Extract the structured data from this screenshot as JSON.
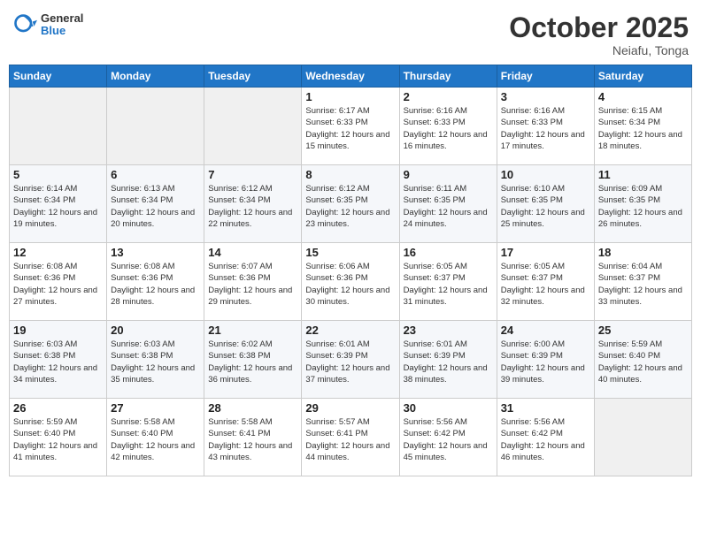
{
  "logo": {
    "general": "General",
    "blue": "Blue"
  },
  "header": {
    "month": "October 2025",
    "location": "Neiafu, Tonga"
  },
  "weekdays": [
    "Sunday",
    "Monday",
    "Tuesday",
    "Wednesday",
    "Thursday",
    "Friday",
    "Saturday"
  ],
  "weeks": [
    [
      {
        "day": "",
        "sunrise": "",
        "sunset": "",
        "daylight": ""
      },
      {
        "day": "",
        "sunrise": "",
        "sunset": "",
        "daylight": ""
      },
      {
        "day": "",
        "sunrise": "",
        "sunset": "",
        "daylight": ""
      },
      {
        "day": "1",
        "sunrise": "Sunrise: 6:17 AM",
        "sunset": "Sunset: 6:33 PM",
        "daylight": "Daylight: 12 hours and 15 minutes."
      },
      {
        "day": "2",
        "sunrise": "Sunrise: 6:16 AM",
        "sunset": "Sunset: 6:33 PM",
        "daylight": "Daylight: 12 hours and 16 minutes."
      },
      {
        "day": "3",
        "sunrise": "Sunrise: 6:16 AM",
        "sunset": "Sunset: 6:33 PM",
        "daylight": "Daylight: 12 hours and 17 minutes."
      },
      {
        "day": "4",
        "sunrise": "Sunrise: 6:15 AM",
        "sunset": "Sunset: 6:34 PM",
        "daylight": "Daylight: 12 hours and 18 minutes."
      }
    ],
    [
      {
        "day": "5",
        "sunrise": "Sunrise: 6:14 AM",
        "sunset": "Sunset: 6:34 PM",
        "daylight": "Daylight: 12 hours and 19 minutes."
      },
      {
        "day": "6",
        "sunrise": "Sunrise: 6:13 AM",
        "sunset": "Sunset: 6:34 PM",
        "daylight": "Daylight: 12 hours and 20 minutes."
      },
      {
        "day": "7",
        "sunrise": "Sunrise: 6:12 AM",
        "sunset": "Sunset: 6:34 PM",
        "daylight": "Daylight: 12 hours and 22 minutes."
      },
      {
        "day": "8",
        "sunrise": "Sunrise: 6:12 AM",
        "sunset": "Sunset: 6:35 PM",
        "daylight": "Daylight: 12 hours and 23 minutes."
      },
      {
        "day": "9",
        "sunrise": "Sunrise: 6:11 AM",
        "sunset": "Sunset: 6:35 PM",
        "daylight": "Daylight: 12 hours and 24 minutes."
      },
      {
        "day": "10",
        "sunrise": "Sunrise: 6:10 AM",
        "sunset": "Sunset: 6:35 PM",
        "daylight": "Daylight: 12 hours and 25 minutes."
      },
      {
        "day": "11",
        "sunrise": "Sunrise: 6:09 AM",
        "sunset": "Sunset: 6:35 PM",
        "daylight": "Daylight: 12 hours and 26 minutes."
      }
    ],
    [
      {
        "day": "12",
        "sunrise": "Sunrise: 6:08 AM",
        "sunset": "Sunset: 6:36 PM",
        "daylight": "Daylight: 12 hours and 27 minutes."
      },
      {
        "day": "13",
        "sunrise": "Sunrise: 6:08 AM",
        "sunset": "Sunset: 6:36 PM",
        "daylight": "Daylight: 12 hours and 28 minutes."
      },
      {
        "day": "14",
        "sunrise": "Sunrise: 6:07 AM",
        "sunset": "Sunset: 6:36 PM",
        "daylight": "Daylight: 12 hours and 29 minutes."
      },
      {
        "day": "15",
        "sunrise": "Sunrise: 6:06 AM",
        "sunset": "Sunset: 6:36 PM",
        "daylight": "Daylight: 12 hours and 30 minutes."
      },
      {
        "day": "16",
        "sunrise": "Sunrise: 6:05 AM",
        "sunset": "Sunset: 6:37 PM",
        "daylight": "Daylight: 12 hours and 31 minutes."
      },
      {
        "day": "17",
        "sunrise": "Sunrise: 6:05 AM",
        "sunset": "Sunset: 6:37 PM",
        "daylight": "Daylight: 12 hours and 32 minutes."
      },
      {
        "day": "18",
        "sunrise": "Sunrise: 6:04 AM",
        "sunset": "Sunset: 6:37 PM",
        "daylight": "Daylight: 12 hours and 33 minutes."
      }
    ],
    [
      {
        "day": "19",
        "sunrise": "Sunrise: 6:03 AM",
        "sunset": "Sunset: 6:38 PM",
        "daylight": "Daylight: 12 hours and 34 minutes."
      },
      {
        "day": "20",
        "sunrise": "Sunrise: 6:03 AM",
        "sunset": "Sunset: 6:38 PM",
        "daylight": "Daylight: 12 hours and 35 minutes."
      },
      {
        "day": "21",
        "sunrise": "Sunrise: 6:02 AM",
        "sunset": "Sunset: 6:38 PM",
        "daylight": "Daylight: 12 hours and 36 minutes."
      },
      {
        "day": "22",
        "sunrise": "Sunrise: 6:01 AM",
        "sunset": "Sunset: 6:39 PM",
        "daylight": "Daylight: 12 hours and 37 minutes."
      },
      {
        "day": "23",
        "sunrise": "Sunrise: 6:01 AM",
        "sunset": "Sunset: 6:39 PM",
        "daylight": "Daylight: 12 hours and 38 minutes."
      },
      {
        "day": "24",
        "sunrise": "Sunrise: 6:00 AM",
        "sunset": "Sunset: 6:39 PM",
        "daylight": "Daylight: 12 hours and 39 minutes."
      },
      {
        "day": "25",
        "sunrise": "Sunrise: 5:59 AM",
        "sunset": "Sunset: 6:40 PM",
        "daylight": "Daylight: 12 hours and 40 minutes."
      }
    ],
    [
      {
        "day": "26",
        "sunrise": "Sunrise: 5:59 AM",
        "sunset": "Sunset: 6:40 PM",
        "daylight": "Daylight: 12 hours and 41 minutes."
      },
      {
        "day": "27",
        "sunrise": "Sunrise: 5:58 AM",
        "sunset": "Sunset: 6:40 PM",
        "daylight": "Daylight: 12 hours and 42 minutes."
      },
      {
        "day": "28",
        "sunrise": "Sunrise: 5:58 AM",
        "sunset": "Sunset: 6:41 PM",
        "daylight": "Daylight: 12 hours and 43 minutes."
      },
      {
        "day": "29",
        "sunrise": "Sunrise: 5:57 AM",
        "sunset": "Sunset: 6:41 PM",
        "daylight": "Daylight: 12 hours and 44 minutes."
      },
      {
        "day": "30",
        "sunrise": "Sunrise: 5:56 AM",
        "sunset": "Sunset: 6:42 PM",
        "daylight": "Daylight: 12 hours and 45 minutes."
      },
      {
        "day": "31",
        "sunrise": "Sunrise: 5:56 AM",
        "sunset": "Sunset: 6:42 PM",
        "daylight": "Daylight: 12 hours and 46 minutes."
      },
      {
        "day": "",
        "sunrise": "",
        "sunset": "",
        "daylight": ""
      }
    ]
  ]
}
